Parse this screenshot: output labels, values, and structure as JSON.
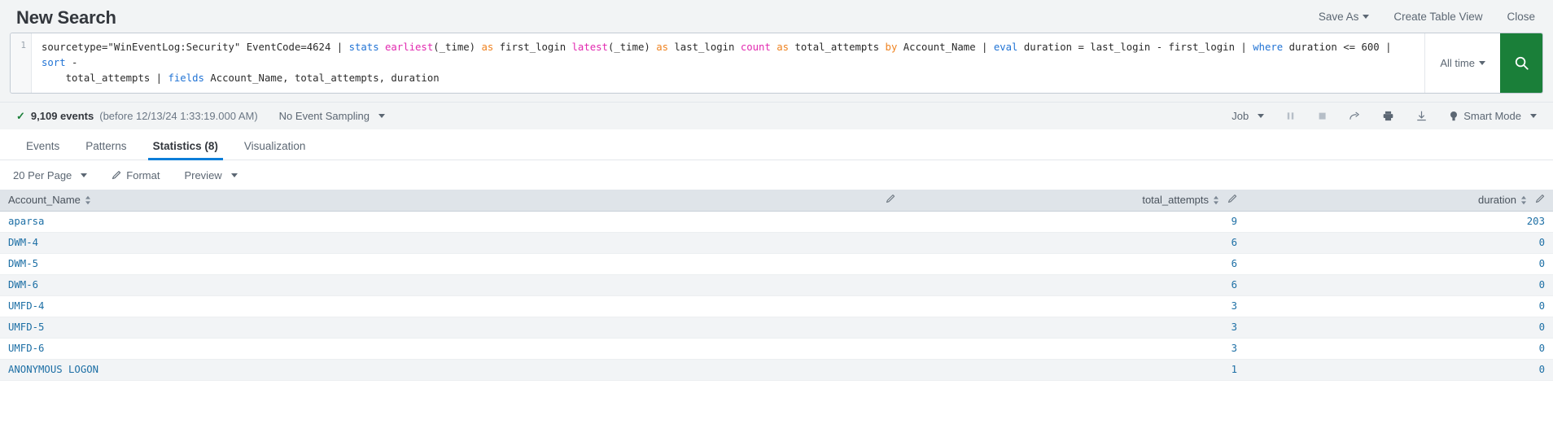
{
  "header": {
    "title": "New Search",
    "actions": [
      {
        "label": "Save As",
        "caret": true
      },
      {
        "label": "Create Table View",
        "caret": false
      },
      {
        "label": "Close",
        "caret": false
      }
    ]
  },
  "search": {
    "line_number": "1",
    "query_tokens": [
      {
        "text": "sourcetype=\"WinEventLog:Security\" EventCode=4624 | ",
        "type": "plain"
      },
      {
        "text": "stats ",
        "type": "cmd"
      },
      {
        "text": "earliest",
        "type": "fn"
      },
      {
        "text": "(_time) ",
        "type": "plain"
      },
      {
        "text": "as ",
        "type": "kw"
      },
      {
        "text": "first_login ",
        "type": "plain"
      },
      {
        "text": "latest",
        "type": "fn"
      },
      {
        "text": "(_time) ",
        "type": "plain"
      },
      {
        "text": "as ",
        "type": "kw"
      },
      {
        "text": "last_login ",
        "type": "plain"
      },
      {
        "text": "count ",
        "type": "fn"
      },
      {
        "text": "as ",
        "type": "kw"
      },
      {
        "text": "total_attempts ",
        "type": "plain"
      },
      {
        "text": "by ",
        "type": "kw"
      },
      {
        "text": "Account_Name | ",
        "type": "plain"
      },
      {
        "text": "eval ",
        "type": "cmd"
      },
      {
        "text": "duration = last_login - first_login | ",
        "type": "plain"
      },
      {
        "text": "where ",
        "type": "cmd"
      },
      {
        "text": "duration <= 600 | ",
        "type": "plain"
      },
      {
        "text": "sort ",
        "type": "cmd"
      },
      {
        "text": "-\n    total_attempts | ",
        "type": "plain"
      },
      {
        "text": "fields ",
        "type": "cmd"
      },
      {
        "text": "Account_Name, total_attempts, duration",
        "type": "plain"
      }
    ],
    "query_plain": "sourcetype=\"WinEventLog:Security\" EventCode=4624 | stats earliest(_time) as first_login latest(_time) as last_login count as total_attempts by Account_Name | eval duration = last_login - first_login | where duration <= 600 | sort - total_attempts | fields Account_Name, total_attempts, duration",
    "time_range": "All time",
    "search_icon": "magnifier-icon"
  },
  "status": {
    "events_count": "9,109 events",
    "events_suffix": "(before 12/13/24 1:33:19.000 AM)",
    "sampling": "No Event Sampling",
    "job": "Job",
    "mode": "Smart Mode",
    "icons": [
      "pause-icon",
      "stop-icon",
      "share-icon",
      "print-icon",
      "export-icon"
    ]
  },
  "tabs": [
    {
      "label": "Events",
      "active": false
    },
    {
      "label": "Patterns",
      "active": false
    },
    {
      "label": "Statistics (8)",
      "active": true
    },
    {
      "label": "Visualization",
      "active": false
    }
  ],
  "table_toolbar": [
    {
      "label": "20 Per Page",
      "caret": true,
      "icon": null
    },
    {
      "label": "Format",
      "caret": false,
      "icon": "pencil-icon"
    },
    {
      "label": "Preview",
      "caret": true,
      "icon": null
    }
  ],
  "table": {
    "columns": [
      {
        "label": "Account_Name",
        "align": "left"
      },
      {
        "label": "total_attempts",
        "align": "right"
      },
      {
        "label": "duration",
        "align": "right"
      }
    ],
    "rows": [
      {
        "account_name": "aparsa",
        "total_attempts": "9",
        "duration": "203"
      },
      {
        "account_name": "DWM-4",
        "total_attempts": "6",
        "duration": "0"
      },
      {
        "account_name": "DWM-5",
        "total_attempts": "6",
        "duration": "0"
      },
      {
        "account_name": "DWM-6",
        "total_attempts": "6",
        "duration": "0"
      },
      {
        "account_name": "UMFD-4",
        "total_attempts": "3",
        "duration": "0"
      },
      {
        "account_name": "UMFD-5",
        "total_attempts": "3",
        "duration": "0"
      },
      {
        "account_name": "UMFD-6",
        "total_attempts": "3",
        "duration": "0"
      },
      {
        "account_name": "ANONYMOUS LOGON",
        "total_attempts": "1",
        "duration": "0"
      }
    ]
  },
  "colors": {
    "accent_link": "#1d6fa5",
    "tab_active": "#0c7dd8",
    "search_button": "#1a7f39",
    "chrome_bg": "#f2f4f5",
    "table_header_bg": "#dfe4e9"
  }
}
